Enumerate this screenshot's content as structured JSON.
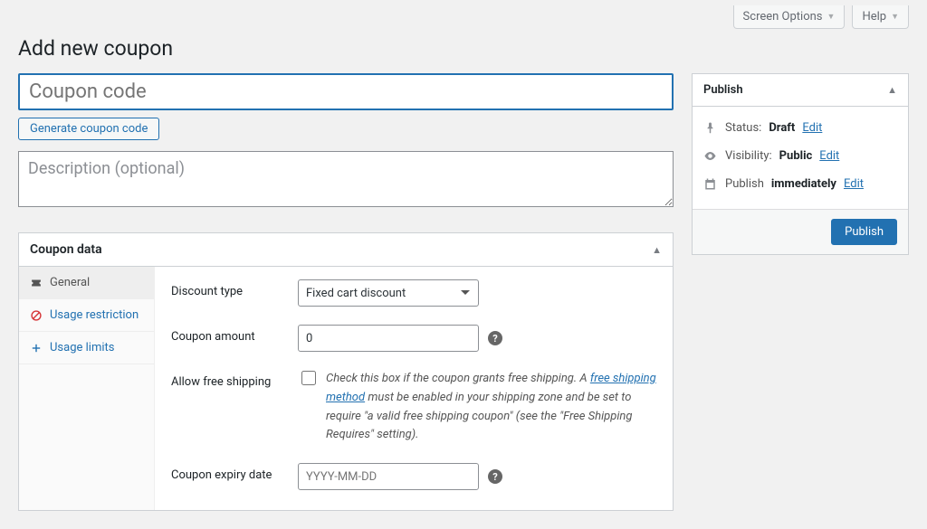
{
  "topbar": {
    "screen_options": "Screen Options",
    "help": "Help"
  },
  "page_title": "Add new coupon",
  "title_placeholder": "Coupon code",
  "generate_label": "Generate coupon code",
  "description_placeholder": "Description (optional)",
  "coupon_data": {
    "heading": "Coupon data",
    "tabs": {
      "general": "General",
      "usage_restriction": "Usage restriction",
      "usage_limits": "Usage limits"
    },
    "general": {
      "discount_type_label": "Discount type",
      "discount_type_value": "Fixed cart discount",
      "coupon_amount_label": "Coupon amount",
      "coupon_amount_value": "0",
      "free_shipping_label": "Allow free shipping",
      "free_shipping_text_before": "Check this box if the coupon grants free shipping. A ",
      "free_shipping_link": "free shipping method",
      "free_shipping_text_after": " must be enabled in your shipping zone and be set to require \"a valid free shipping coupon\" (see the \"Free Shipping Requires\" setting).",
      "expiry_label": "Coupon expiry date",
      "expiry_placeholder": "YYYY-MM-DD"
    }
  },
  "publish": {
    "heading": "Publish",
    "status_label": "Status:",
    "status_value": "Draft",
    "visibility_label": "Visibility:",
    "visibility_value": "Public",
    "schedule_label": "Publish",
    "schedule_value": "immediately",
    "edit": "Edit",
    "button": "Publish"
  }
}
